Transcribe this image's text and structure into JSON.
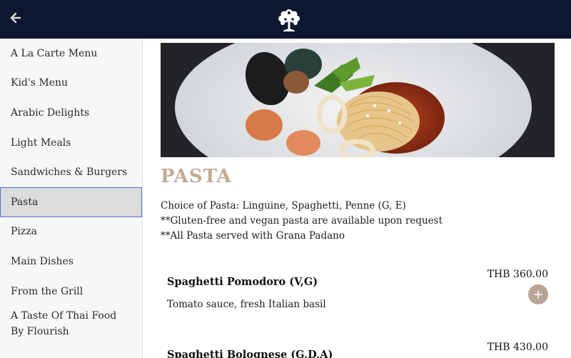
{
  "header": {
    "back_icon": "arrow-left-icon",
    "logo_icon": "tree-logo-icon"
  },
  "sidebar": {
    "items": [
      {
        "label": "A La Carte Menu"
      },
      {
        "label": "Kid's Menu"
      },
      {
        "label": "Arabic Delights"
      },
      {
        "label": "Light Meals"
      },
      {
        "label": "Sandwiches & Burgers"
      },
      {
        "label": "Pasta",
        "active": true
      },
      {
        "label": "Pizza"
      },
      {
        "label": "Main Dishes"
      },
      {
        "label": "From the Grill"
      },
      {
        "label": "A Taste Of Thai Food By Flourish"
      }
    ]
  },
  "main": {
    "title": "PASTA",
    "description": [
      "Choice of Pasta: Linguine, Spaghetti, Penne (G, E)",
      "**Gluten-free and vegan pasta are available upon request",
      "**All Pasta served with Grana Padano"
    ],
    "dishes": [
      {
        "name": "Spaghetti Pomodoro (V,G)",
        "price": "THB 360.00",
        "description": "Tomato sauce, fresh Italian basil",
        "add_label": "+"
      },
      {
        "name": "Spaghetti Bolognese (G,D,A)",
        "price": "THB 430.00"
      }
    ]
  },
  "colors": {
    "header_bg": "#0d1730",
    "title_color": "#c2aa95",
    "add_button": "#b9a597",
    "active_border": "#4d73c8"
  }
}
